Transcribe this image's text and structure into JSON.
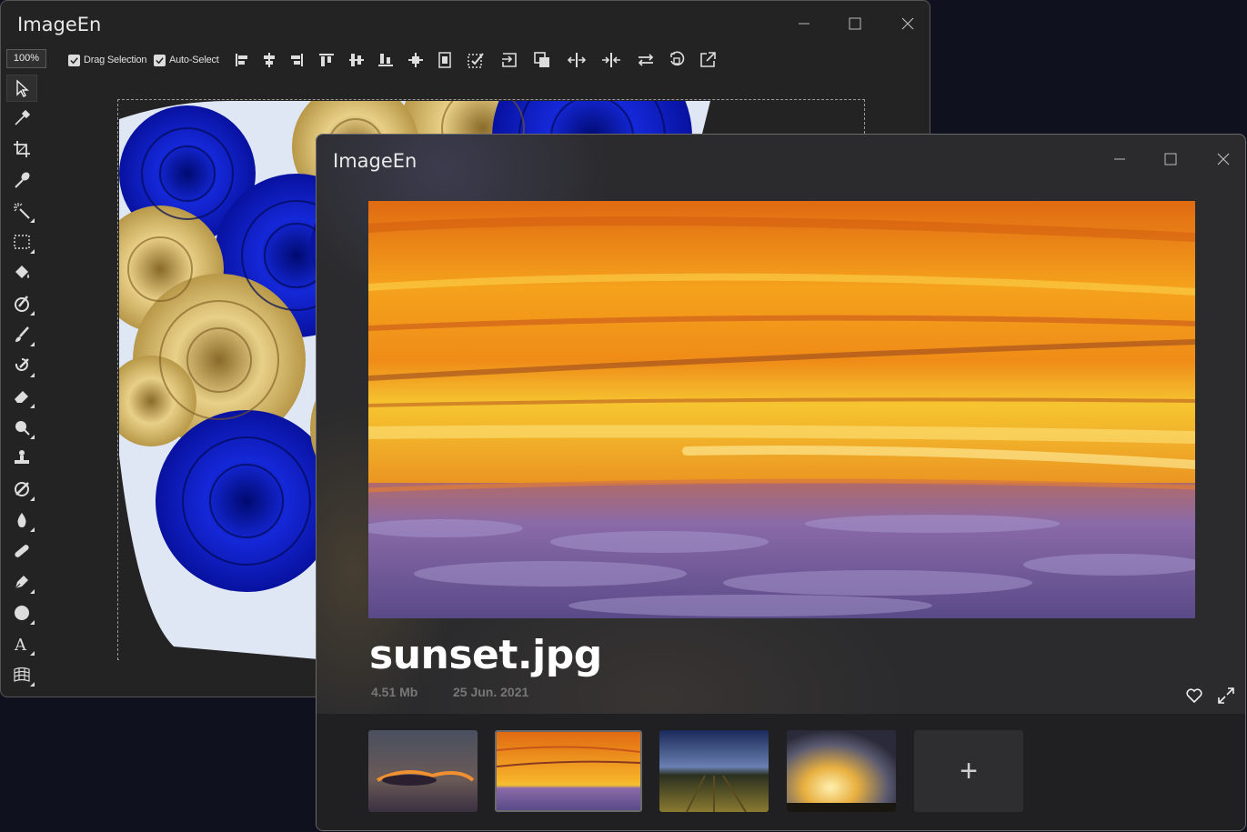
{
  "editor_window": {
    "title": "ImageEn",
    "toolbar": {
      "zoom": "100%",
      "drag_selection_label": "Drag Selection",
      "drag_selection_checked": true,
      "auto_select_label": "Auto-Select",
      "auto_select_checked": true,
      "icons": [
        "align-left-icon",
        "align-center-icon",
        "align-right-icon",
        "align-top-icon",
        "align-middle-icon",
        "align-bottom-icon",
        "center-icon",
        "fit-icon",
        "select-all-icon",
        "send-front-icon",
        "bring-forward-icon",
        "flip-horizontal-icon",
        "shrink-horizontal-icon",
        "swap-icon",
        "rotate-icon",
        "export-icon"
      ]
    },
    "tools": [
      "select-arrow-icon",
      "eyedropper-icon",
      "crop-icon",
      "pipette-icon",
      "magic-wand-icon",
      "marquee-selection-icon",
      "paint-bucket-icon",
      "clone-brush-icon",
      "brush-icon",
      "healing-brush-icon",
      "eraser-icon",
      "blur-icon",
      "stamp-icon",
      "dodge-icon",
      "drop-icon",
      "bandage-icon",
      "pen-icon",
      "ellipse-icon",
      "text-icon",
      "grid-warp-icon"
    ]
  },
  "viewer_window": {
    "title": "ImageEn",
    "filename": "sunset.jpg",
    "size": "4.51 Mb",
    "date": "25 Jun. 2021",
    "thumbnails": [
      "thumb-dusk-clouds",
      "thumb-sunset-selected",
      "thumb-vineyard",
      "thumb-golden-sky"
    ],
    "add_label": "+"
  },
  "colors": {
    "background": "#10111f",
    "window_bg": "#232323",
    "rose_blue": "#0a1ab8",
    "rose_gold": "#d8b860",
    "sunset_orange": "#f08a10"
  }
}
